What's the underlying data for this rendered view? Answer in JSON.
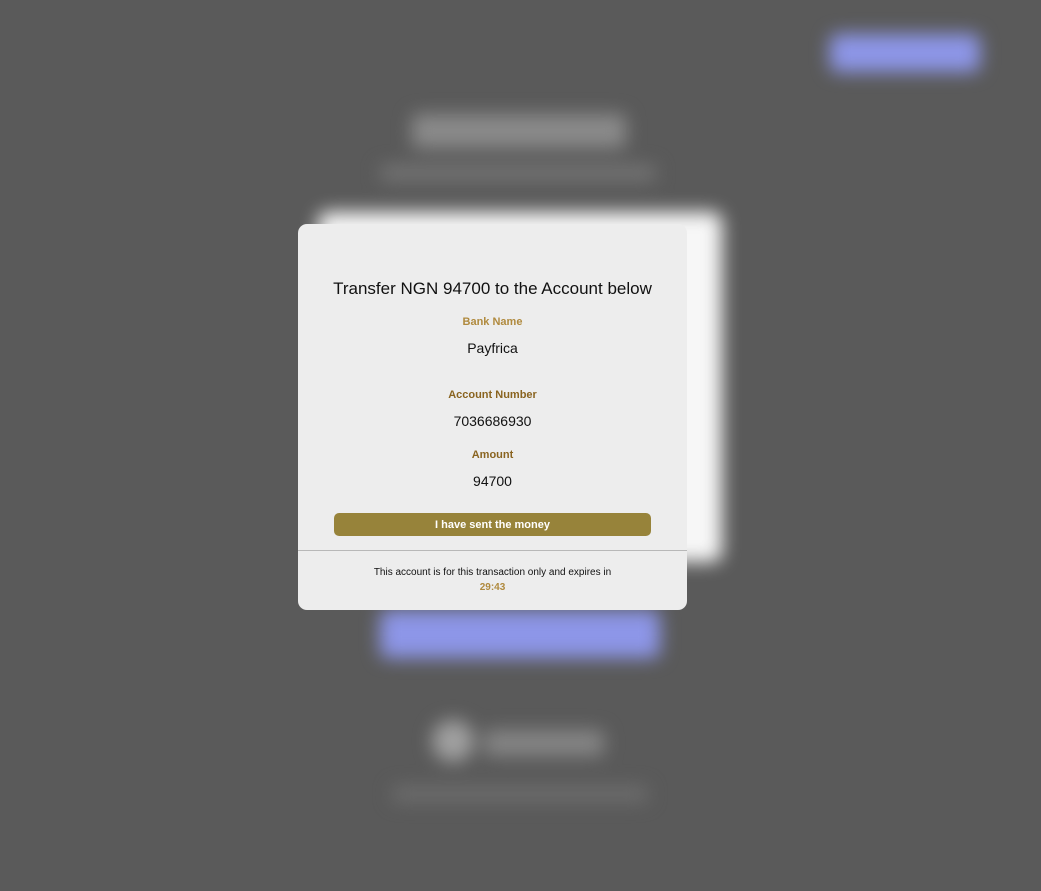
{
  "colors": {
    "overlay": "#5a5a5a",
    "modal_background": "#ededed",
    "label_gold": "#b08a3e",
    "label_brown": "#8a6420",
    "button_olive": "#97833a",
    "timer_gold": "#b08a3e",
    "background_accent": "#8d96e8"
  },
  "modal": {
    "title": "Transfer NGN 94700 to the Account below",
    "bank_name": {
      "label": "Bank Name",
      "value": "Payfrica"
    },
    "account_number": {
      "label": "Account Number",
      "value": "7036686930"
    },
    "amount": {
      "label": "Amount",
      "value": "94700"
    },
    "confirm_button_label": "I have sent the money",
    "expiry_notice": "This account is for this transaction only and expires in",
    "expiry_timer": "29:43"
  }
}
